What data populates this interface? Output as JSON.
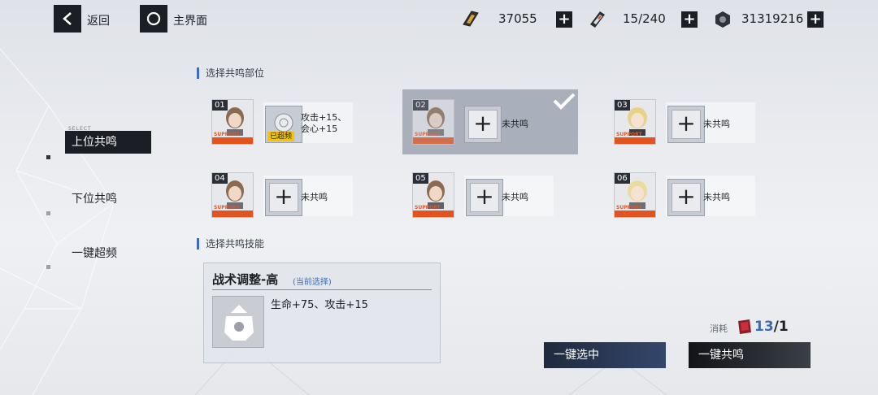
{
  "topbar": {
    "back_label": "返回",
    "home_label": "主界面",
    "resources": [
      {
        "icon": "gold-bar-icon",
        "value": "37055"
      },
      {
        "icon": "stamina-battery-icon",
        "value": "15/240"
      },
      {
        "icon": "hex-nut-icon",
        "value": "31319216"
      }
    ]
  },
  "nav": {
    "select_tag": "SELECT",
    "items": [
      {
        "label": "上位共鸣",
        "active": true
      },
      {
        "label": "下位共鸣",
        "active": false
      },
      {
        "label": "一键超频",
        "active": false
      }
    ]
  },
  "slots_section": {
    "title": "选择共鸣部位"
  },
  "slots": [
    {
      "num": "01",
      "tag": "SUPPORT",
      "status": "攻击+15、",
      "status2": "会心+15",
      "badge": "已超频",
      "selected": false
    },
    {
      "num": "02",
      "tag": "SUPPORT",
      "status": "未共鸣",
      "selected": true
    },
    {
      "num": "03",
      "tag": "SUPPORT",
      "status": "未共鸣",
      "selected": false
    },
    {
      "num": "04",
      "tag": "SUPPORT",
      "status": "未共鸣",
      "selected": false
    },
    {
      "num": "05",
      "tag": "SUPPORT",
      "status": "未共鸣",
      "selected": false
    },
    {
      "num": "06",
      "tag": "SUPPORT",
      "status": "未共鸣",
      "selected": false
    }
  ],
  "skill_section": {
    "title": "选择共鸣技能"
  },
  "skill": {
    "name": "战术调整-高",
    "current": "(当前选择)",
    "desc": "生命+75、攻击+15"
  },
  "cost": {
    "label": "消耗",
    "value": "13",
    "required": "/1"
  },
  "buttons": {
    "select_all": "一键选中",
    "resonate_all": "一键共鸣"
  },
  "colors": {
    "accent_blue": "#3d6bb8",
    "dark": "#1b1e24",
    "support_orange": "#e2541f",
    "badge_yellow": "#f5c400"
  }
}
